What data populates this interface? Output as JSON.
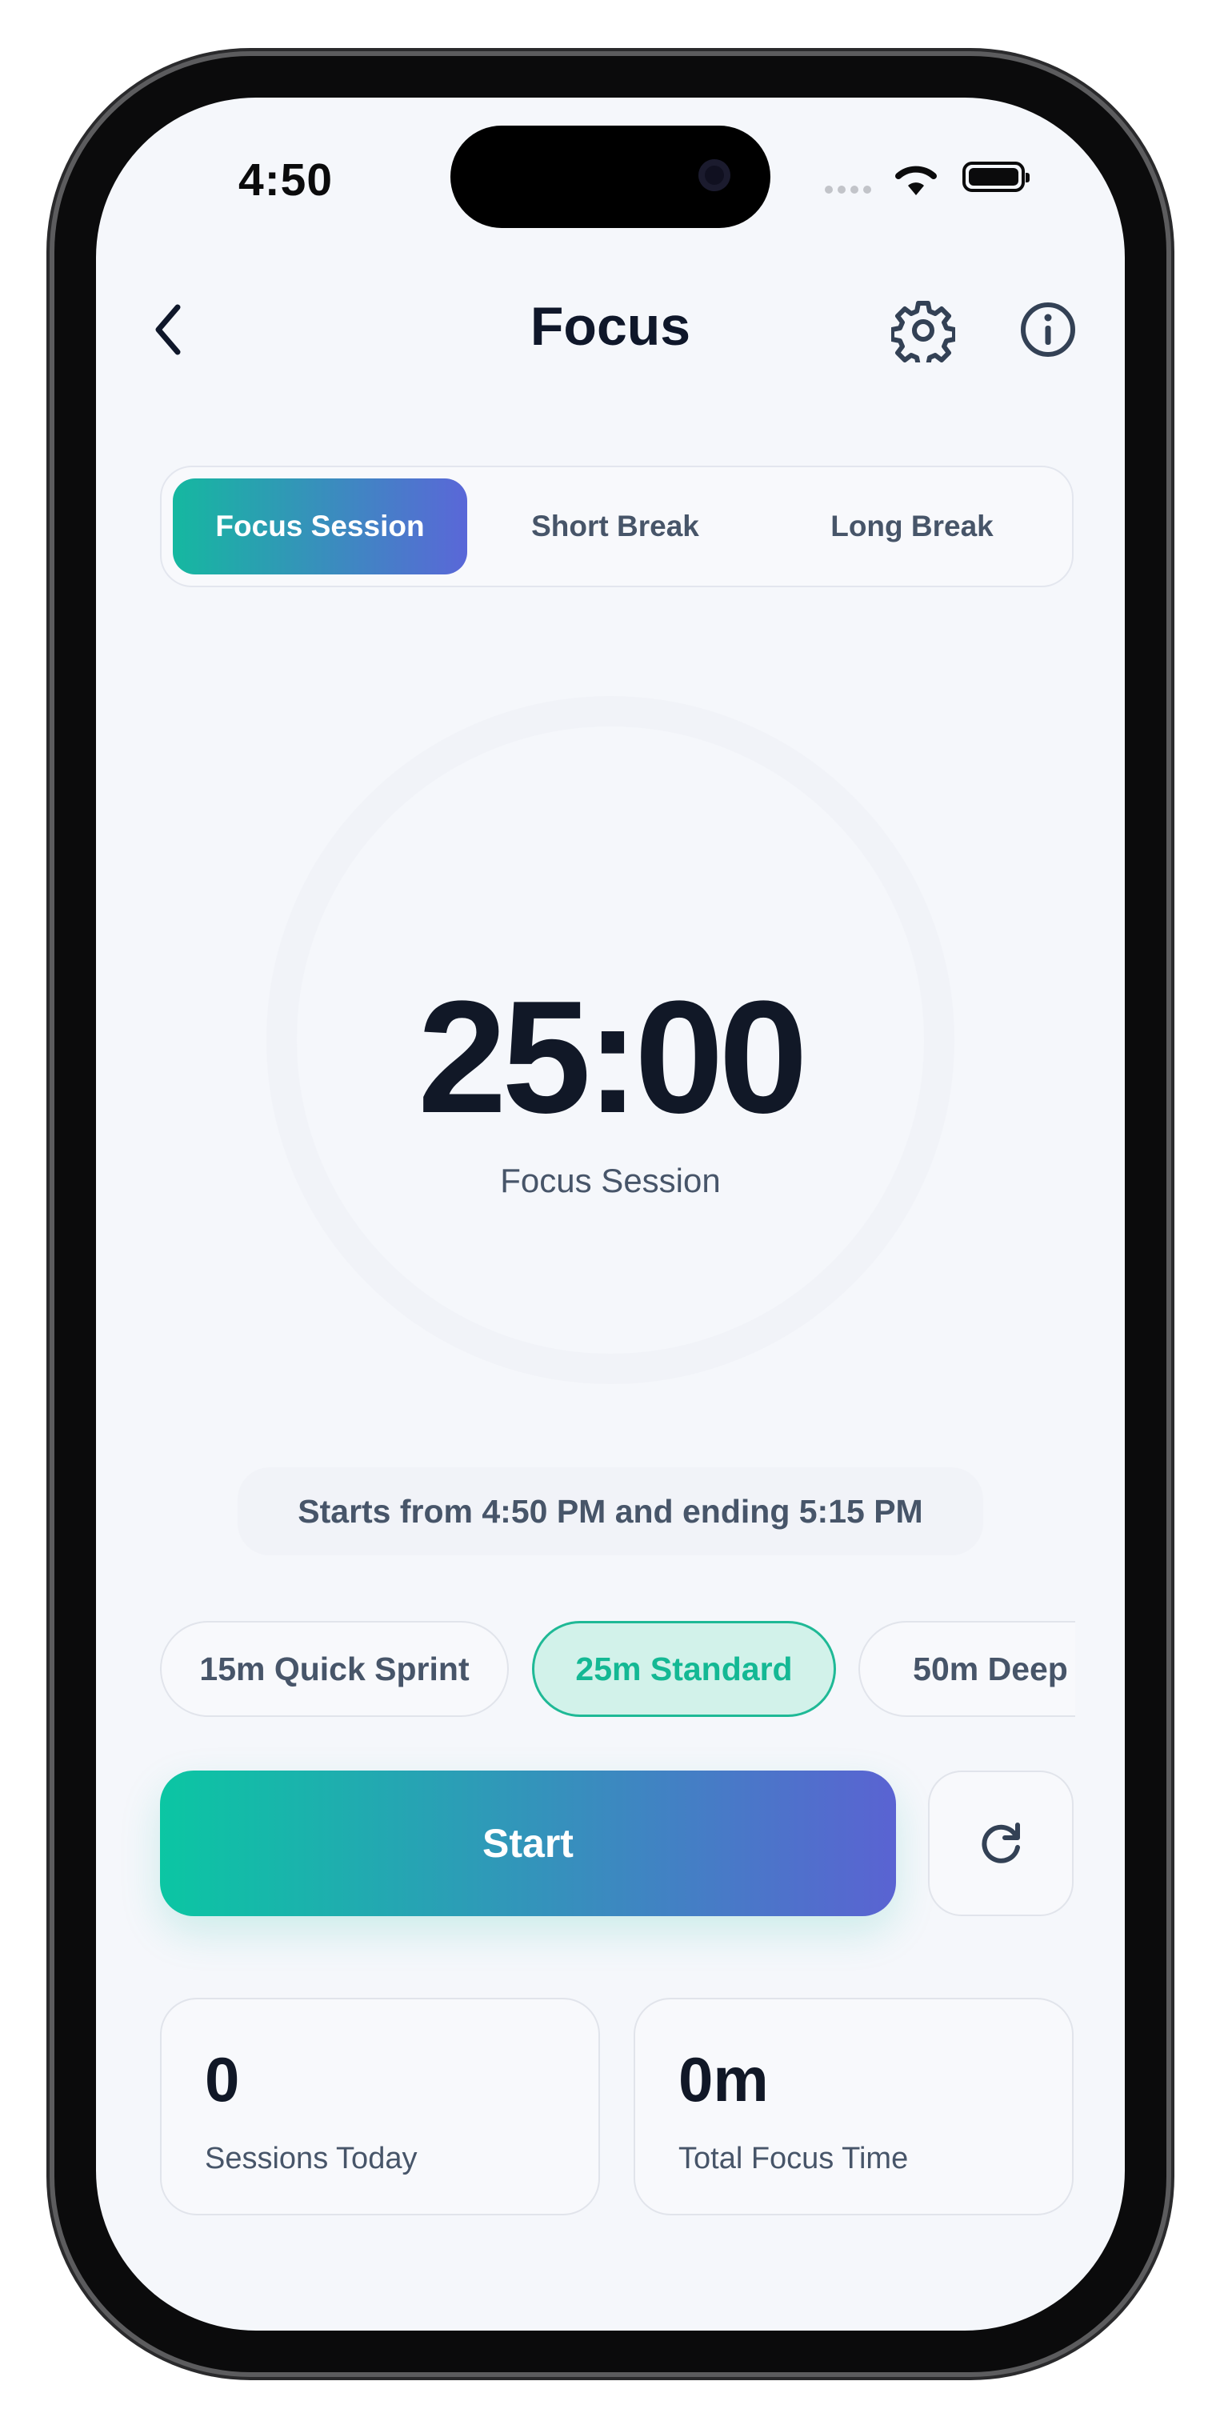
{
  "status_bar": {
    "time": "4:50"
  },
  "header": {
    "title": "Focus"
  },
  "modes": [
    {
      "label": "Focus Session",
      "active": true
    },
    {
      "label": "Short Break",
      "active": false
    },
    {
      "label": "Long Break",
      "active": false
    }
  ],
  "timer": {
    "time": "25:00",
    "label": "Focus Session"
  },
  "schedule_text": "Starts from 4:50 PM and ending 5:15 PM",
  "presets": [
    {
      "label": "15m Quick Sprint",
      "active": false
    },
    {
      "label": "25m Standard",
      "active": true
    },
    {
      "label": "50m Deep",
      "active": false
    }
  ],
  "actions": {
    "start_label": "Start"
  },
  "stats": [
    {
      "value": "0",
      "label": "Sessions Today"
    },
    {
      "value": "0m",
      "label": "Total Focus Time"
    }
  ],
  "colors": {
    "accent_start": "#15b8a0",
    "accent_end": "#5a67d8",
    "text_primary": "#0f172a",
    "text_secondary": "#475569",
    "preset_active_bg": "#d2f2ea"
  },
  "icons": {
    "back": "chevron-left-icon",
    "settings": "gear-icon",
    "info": "info-icon",
    "reset": "refresh-icon"
  }
}
